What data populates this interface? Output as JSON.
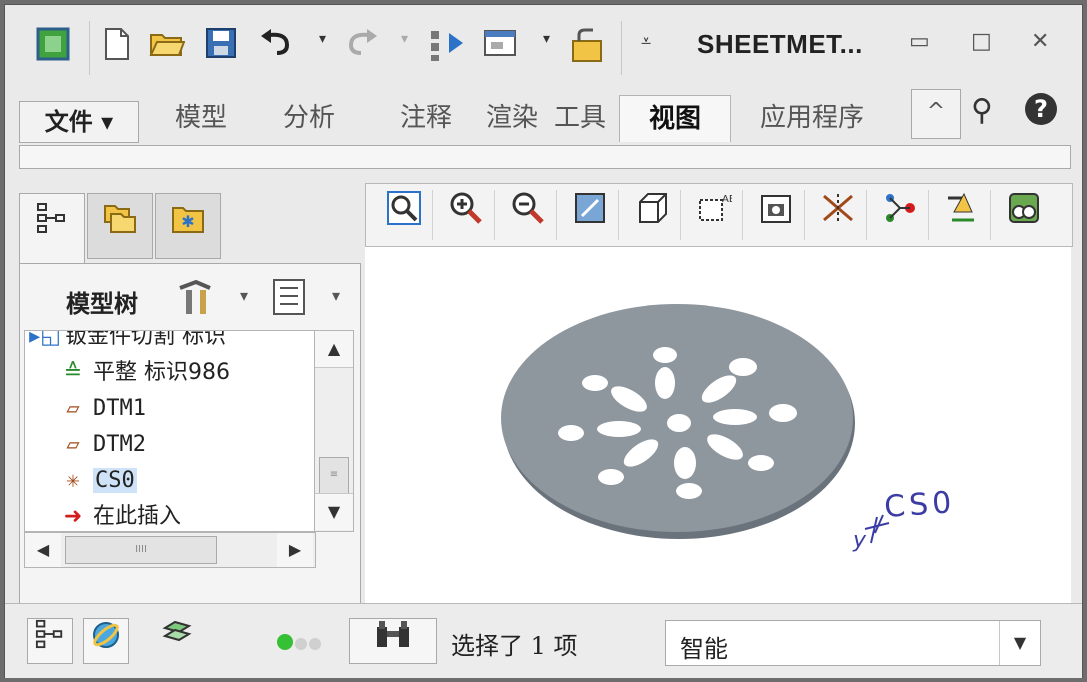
{
  "window": {
    "title": "SHEETMET..."
  },
  "quick_access": {
    "icons": [
      "app-logo-icon",
      "new-icon",
      "open-icon",
      "save-icon",
      "undo-icon",
      "redo-icon",
      "regenerate-icon",
      "window-icon",
      "close-window-icon",
      "customize-icon"
    ]
  },
  "window_controls": {
    "minimize": "▭",
    "maximize": "□",
    "close": "✕"
  },
  "ribbon": {
    "file_label": "文件 ▾",
    "tabs": [
      {
        "label": "模型"
      },
      {
        "label": "分析"
      },
      {
        "label": "注释"
      },
      {
        "label": "渲染"
      },
      {
        "label": "工具"
      },
      {
        "label": "视图"
      },
      {
        "label": "应用程序"
      }
    ],
    "active_tab": "视图",
    "collapse_glyph": "^",
    "search_glyph": "⚲",
    "help_glyph": "?"
  },
  "navigator": {
    "tab_glyphs": [
      "⛶",
      "❐",
      "✱"
    ],
    "model_tree_label": "模型树",
    "settings_glyph": "⚒",
    "show_glyph": "☰",
    "dropdown": "▾"
  },
  "model_tree": {
    "items": [
      {
        "label": "钣金件切割 标识",
        "icon": "sheetmetal-cut-icon",
        "glyph": "▸◱",
        "partial": true
      },
      {
        "label": "平整 标识986",
        "icon": "flatten-icon",
        "glyph": "≙"
      },
      {
        "label": "DTM1",
        "icon": "datum-plane-icon",
        "glyph": "▱"
      },
      {
        "label": "DTM2",
        "icon": "datum-plane-icon",
        "glyph": "▱"
      },
      {
        "label": "CS0",
        "icon": "coordinate-system-icon",
        "glyph": "✳",
        "selected": true
      },
      {
        "label": "在此插入",
        "icon": "insert-here-icon",
        "glyph": "➜"
      }
    ]
  },
  "scrollbars": {
    "up": "▲",
    "down": "▼",
    "left": "◀",
    "right": "▶",
    "grip": "≡",
    "hgrip": "IIII"
  },
  "graphics_toolbar": {
    "icons": [
      {
        "name": "refit-icon",
        "glyph": "⊡"
      },
      {
        "name": "zoom-in-icon",
        "glyph": "⊕"
      },
      {
        "name": "zoom-out-icon",
        "glyph": "⊖"
      },
      {
        "name": "repaint-icon",
        "glyph": "▨"
      },
      {
        "name": "display-style-icon",
        "glyph": "◫"
      },
      {
        "name": "saved-orientations-icon",
        "glyph": "⬚"
      },
      {
        "name": "view-manager-icon",
        "glyph": "▣"
      },
      {
        "name": "datum-display-filters-icon",
        "glyph": "✕"
      },
      {
        "name": "spin-center-icon",
        "glyph": "⊶"
      },
      {
        "name": "annotation-display-icon",
        "glyph": "⊻"
      },
      {
        "name": "appearance-icon",
        "glyph": "⊞"
      }
    ]
  },
  "graphics": {
    "coord_sys_label": "CS0",
    "axis_y_label": "y",
    "disc_fill": "#8e969e",
    "disc_edge": "#6a737c",
    "annotation_color": "#3c3ca5"
  },
  "status_bar": {
    "message": "选择了 1 项",
    "filter_value": "智能",
    "filter_dropdown": "▼",
    "status_light_color": "#35c035",
    "find_glyph": "⛯"
  }
}
